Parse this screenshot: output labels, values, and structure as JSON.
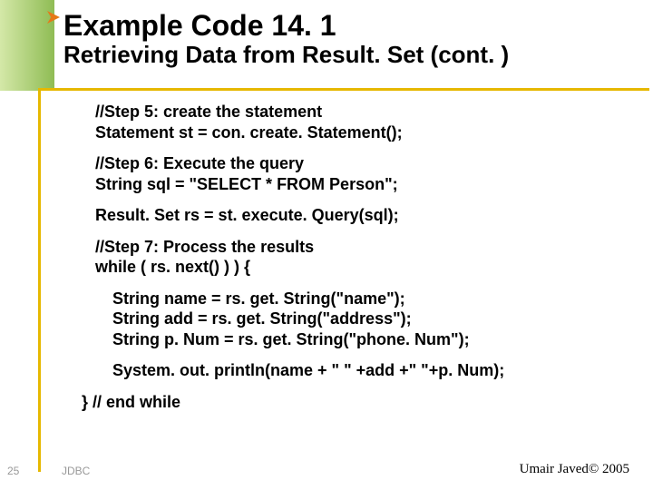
{
  "header": {
    "title": "Example Code 14. 1",
    "subtitle": "Retrieving Data from Result. Set (cont. )"
  },
  "code": {
    "step5a": "//Step 5: create the statement",
    "step5b": "Statement st = con. create. Statement();",
    "step6a": "//Step 6: Execute the query",
    "step6b": "String sql = \"SELECT * FROM Person\";",
    "rs": "Result. Set rs = st. execute. Query(sql);",
    "step7a": "//Step 7: Process the results",
    "step7b": "while ( rs. next() ) ) {",
    "inner1": "String name = rs. get. String(\"name\");",
    "inner2": "String add  = rs. get. String(\"address\");",
    "inner3": "String p. Num = rs. get. String(\"phone. Num\");",
    "inner4": "System. out. println(name + \" \" +add +\" \"+p. Num);",
    "endwhile": "} // end while"
  },
  "footer": {
    "slide_number": "25",
    "label": "JDBC",
    "author": "Umair Javed© 2005"
  }
}
